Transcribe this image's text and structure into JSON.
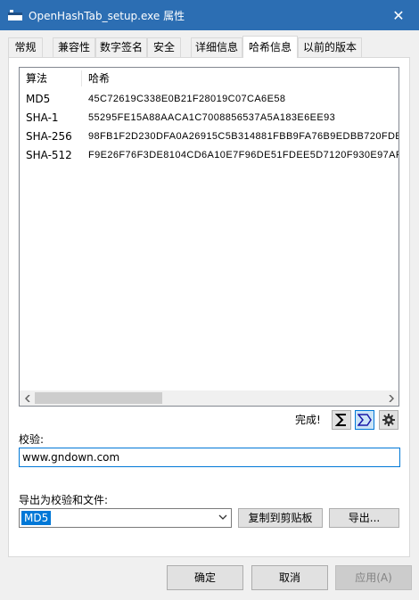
{
  "window": {
    "title": "OpenHashTab_setup.exe 属性",
    "close_glyph": "✕"
  },
  "tabs": [
    {
      "label": "常规"
    },
    {
      "label": "兼容性"
    },
    {
      "label": "数字签名"
    },
    {
      "label": "安全"
    },
    {
      "label": "详细信息"
    },
    {
      "label": "哈希信息",
      "active": true
    },
    {
      "label": "以前的版本"
    }
  ],
  "hash_list": {
    "columns": [
      "算法",
      "哈希"
    ],
    "rows": [
      {
        "algorithm": "MD5",
        "hash": "45C72619C338E0B21F28019C07CA6E58"
      },
      {
        "algorithm": "SHA-1",
        "hash": "55295FE15A88AACA1C7008856537A5A183E6EE93"
      },
      {
        "algorithm": "SHA-256",
        "hash": "98FB1F2D230DFA0A26915C5B314881FBB9FA76B9EDBB720FDE"
      },
      {
        "algorithm": "SHA-512",
        "hash": "F9E26F76F3DE8104CD6A10E7F96DE51FDEE5D7120F930E97AF"
      }
    ]
  },
  "status": {
    "text": "完成!",
    "icons": [
      "sum-icon",
      "checksum-icon",
      "gear-icon"
    ]
  },
  "verify": {
    "label": "校验:",
    "value": "www.gndown.com"
  },
  "export": {
    "label": "导出为校验和文件:",
    "selected": "MD5",
    "copy_button": "复制到剪贴板",
    "export_button": "导出..."
  },
  "footer": {
    "ok": "确定",
    "cancel": "取消",
    "apply": "应用(A)"
  },
  "colors": {
    "titlebar": "#2c6eb3",
    "accent": "#0078d7"
  }
}
